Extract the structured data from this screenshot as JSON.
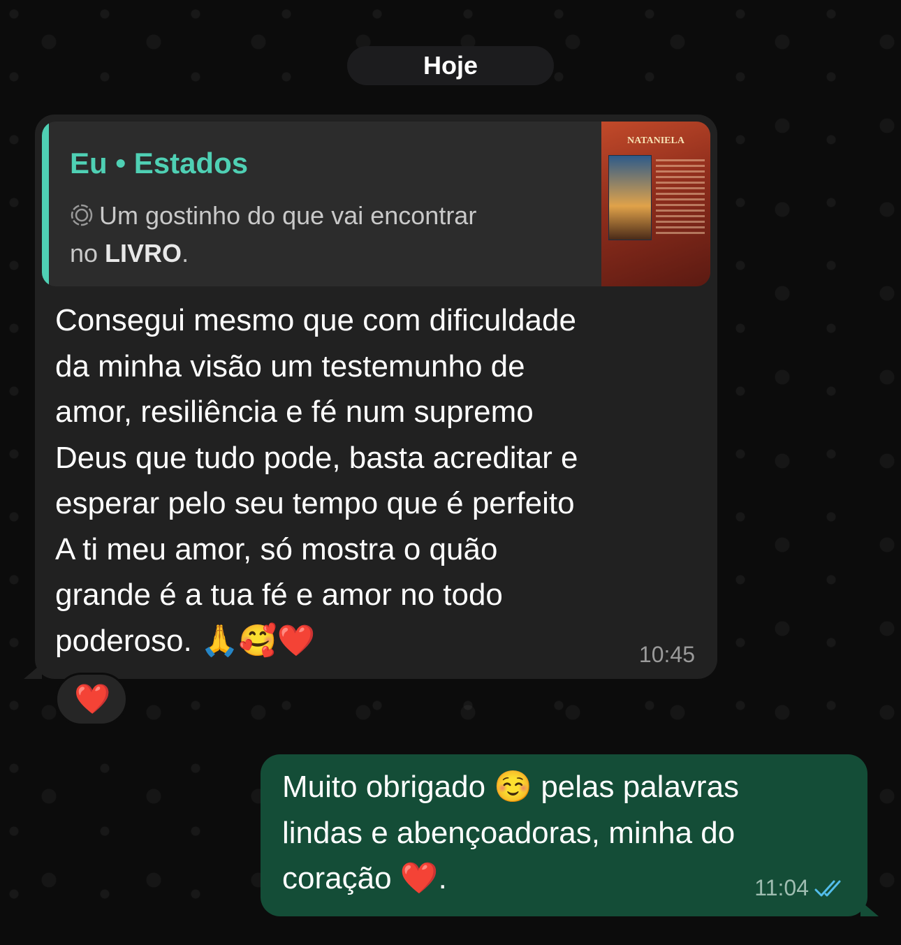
{
  "date_separator": "Hoje",
  "incoming_message": {
    "quote": {
      "author": "Eu • Estados",
      "text_main": "Um gostinho do que vai encontrar",
      "text_prefix": "no ",
      "text_bold": "LIVRO",
      "text_suffix": ".",
      "thumbnail_title": "NATANIELA"
    },
    "text": "Consegui mesmo que com dificuldade\nda minha visão um testemunho de\namor, resiliência e fé num supremo\nDeus que tudo pode, basta acreditar e\nesperar pelo seu tempo que é perfeito\nA ti meu amor, só mostra o quão\ngrande é a tua fé e amor no todo",
    "last_line_text": "poderoso.",
    "last_line_emojis": "🙏🥰❤️",
    "time": "10:45",
    "reaction": "❤️"
  },
  "outgoing_message": {
    "text_part1": "Muito obrigado ",
    "emoji1": "☺️",
    "text_part2": " pelas palavras\nlindas e abençoadoras, minha do\ncoração ",
    "emoji2": "❤️",
    "text_part3": ".",
    "time": "11:04",
    "status": "read"
  },
  "colors": {
    "quote_accent": "#4fd0b4",
    "outgoing_bubble": "#144d37",
    "incoming_bubble": "#212121",
    "read_ticks": "#53bdeb"
  },
  "icons": {
    "status": "status-ring-icon",
    "ticks": "double-check-icon"
  }
}
